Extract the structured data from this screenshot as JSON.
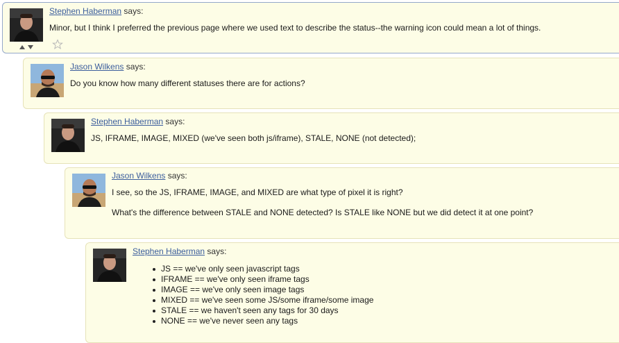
{
  "comments": [
    {
      "author": "Stephen Haberman",
      "says": "says:",
      "lines": [
        "Minor, but I think I preferred the previous page where we used text to describe the status--the warning icon could mean a lot of things."
      ]
    },
    {
      "author": "Jason Wilkens",
      "says": "says:",
      "lines": [
        "Do you know how many different statuses there are for actions?"
      ]
    },
    {
      "author": "Stephen Haberman",
      "says": "says:",
      "lines": [
        "JS, IFRAME, IMAGE, MIXED (we've seen both js/iframe), STALE, NONE (not detected);"
      ]
    },
    {
      "author": "Jason Wilkens",
      "says": "says:",
      "lines": [
        "I see, so the JS, IFRAME, IMAGE, and MIXED are what type of pixel it is right?",
        "What's the difference between STALE and NONE detected? Is STALE like NONE but we did detect it at one point?"
      ]
    },
    {
      "author": "Stephen Haberman",
      "says": "says:",
      "list": [
        "JS == we've only seen javascript tags",
        "IFRAME == we've only seen iframe tags",
        "IMAGE == we've only seen image tags",
        "MIXED == we've seen some JS/some iframe/some image",
        "STALE == we haven't seen any tags for 30 days",
        "NONE == we've never seen any tags"
      ]
    }
  ],
  "icons": {
    "vote": "vote-arrows-icon",
    "favorite": "star-outline-icon"
  },
  "colors": {
    "comment_bg": "#fdfde6",
    "comment_border": "#e6e2b8",
    "selected_border": "#94a8c9",
    "link": "#3b5d9c"
  }
}
